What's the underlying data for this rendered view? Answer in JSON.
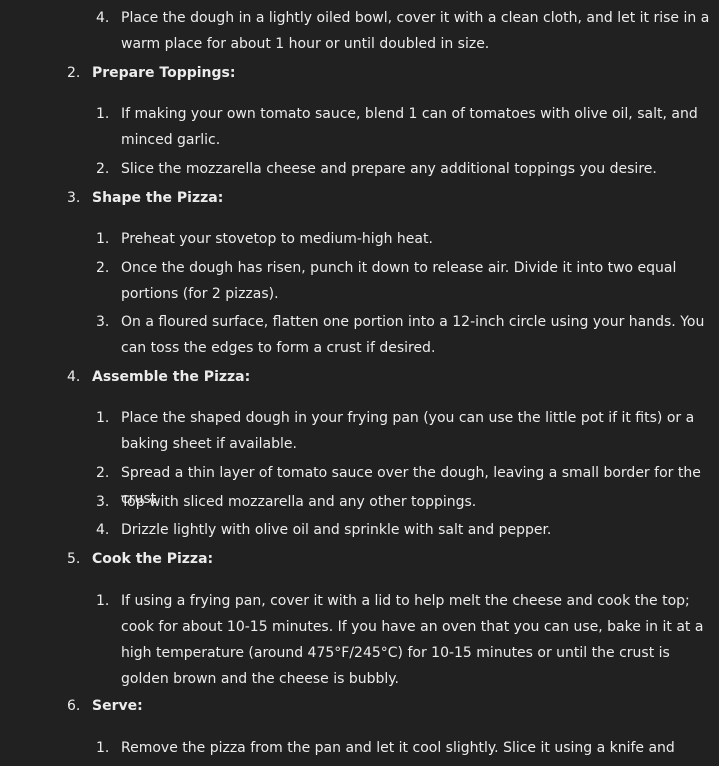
{
  "steps": [
    {
      "num": "",
      "title": "",
      "substeps": [
        {
          "num": "4.",
          "text": "Place the dough in a lightly oiled bowl, cover it with a clean cloth, and let it rise in a warm place for about 1 hour or until doubled in size."
        }
      ]
    },
    {
      "num": "2.",
      "title": "Prepare Toppings:",
      "substeps": [
        {
          "num": "1.",
          "text": "If making your own tomato sauce, blend 1 can of tomatoes with olive oil, salt, and minced garlic."
        },
        {
          "num": "2.",
          "text": "Slice the mozzarella cheese and prepare any additional toppings you desire."
        }
      ]
    },
    {
      "num": "3.",
      "title": "Shape the Pizza:",
      "substeps": [
        {
          "num": "1.",
          "text": "Preheat your stovetop to medium-high heat."
        },
        {
          "num": "2.",
          "text": "Once the dough has risen, punch it down to release air. Divide it into two equal portions (for 2 pizzas)."
        },
        {
          "num": "3.",
          "text": "On a floured surface, flatten one portion into a 12-inch circle using your hands. You can toss the edges to form a crust if desired."
        }
      ]
    },
    {
      "num": "4.",
      "title": "Assemble the Pizza:",
      "substeps": [
        {
          "num": "1.",
          "text": "Place the shaped dough in your frying pan (you can use the little pot if it fits) or a baking sheet if available."
        },
        {
          "num": "2.",
          "text": "Spread a thin layer of tomato sauce over the dough, leaving a small border for the crust."
        },
        {
          "num": "3.",
          "text": "Top with sliced mozzarella and any other toppings."
        },
        {
          "num": "4.",
          "text": "Drizzle lightly with olive oil and sprinkle with salt and pepper."
        }
      ]
    },
    {
      "num": "5.",
      "title": "Cook the Pizza:",
      "substeps": [
        {
          "num": "1.",
          "text": "If using a frying pan, cover it with a lid to help melt the cheese and cook the top; cook for about 10-15 minutes. If you have an oven that you can use, bake in it at a high temperature (around 475°F/245°C) for 10-15 minutes or until the crust is golden brown and the cheese is bubbly."
        }
      ]
    },
    {
      "num": "6.",
      "title": "Serve:",
      "substeps": [
        {
          "num": "1.",
          "text": "Remove the pizza from the pan and let it cool slightly. Slice it using a knife and serve hot."
        }
      ]
    }
  ]
}
